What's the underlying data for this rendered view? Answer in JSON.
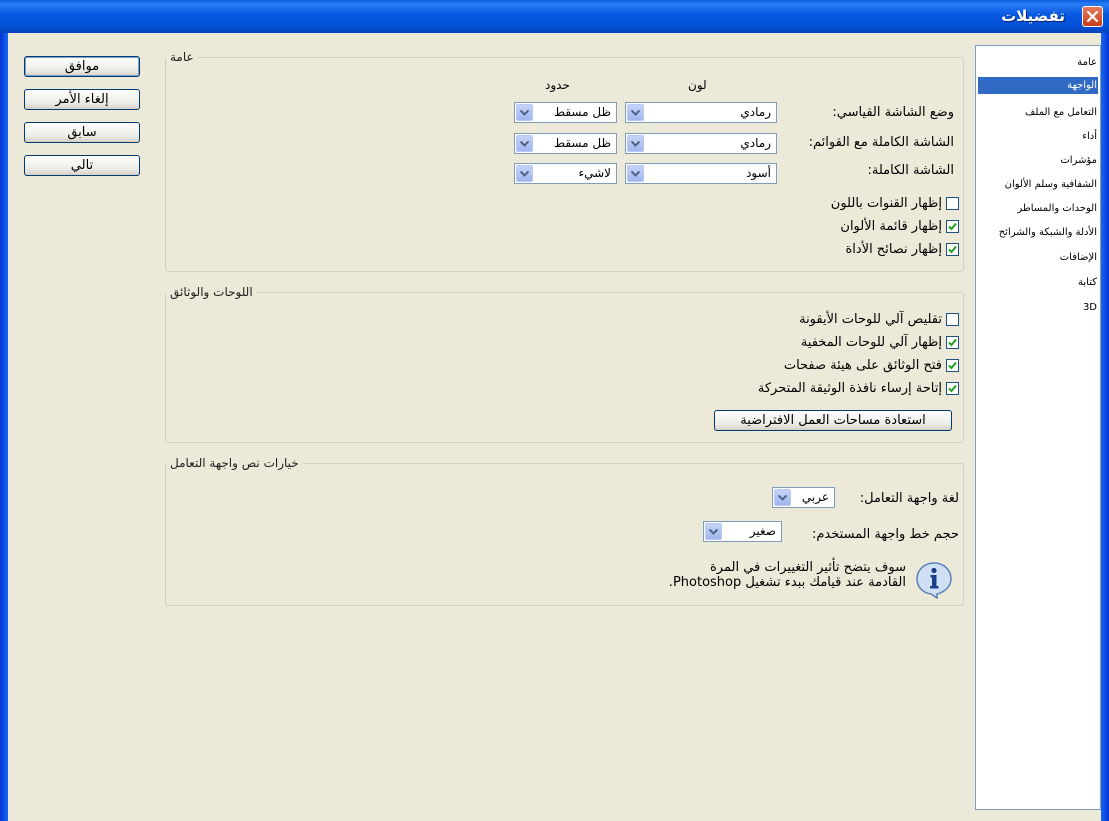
{
  "window": {
    "title": "تفضيلات"
  },
  "buttons": {
    "ok": "موافق",
    "cancel": "إلغاء الأمر",
    "prev": "سابق",
    "next": "تالي"
  },
  "sidebar": {
    "items": [
      "عامة",
      "الواجهة",
      "التعامل مع الملف",
      "أداء",
      "مؤشرات",
      "الشفافية وسلم الألوان",
      "الوحدات والمساطر",
      "الأدلة والشبكة والشرائح",
      "الإضافات",
      "كتابة",
      "3D"
    ],
    "selected": "الواجهة"
  },
  "general": {
    "legend": "عامة",
    "col_color": "لون",
    "col_border": "حدود",
    "rows": [
      {
        "label": "وضع الشاشة القياسي:",
        "color": "رمادي",
        "border": "ظل مسقط"
      },
      {
        "label": "الشاشة الكاملة مع القوائم:",
        "color": "رمادي",
        "border": "ظل مسقط"
      },
      {
        "label": "الشاشة الكاملة:",
        "color": "أسود",
        "border": "لاشيء"
      }
    ],
    "checks": [
      {
        "label": "إظهار القنوات باللون",
        "checked": false
      },
      {
        "label": "إظهار قائمة الألوان",
        "checked": true
      },
      {
        "label": "إظهار نصائح الأداة",
        "checked": true
      }
    ]
  },
  "panels": {
    "legend": "اللوحات والوثائق",
    "checks": [
      {
        "label": "تقليص آلي للوحات الأيقونة",
        "checked": false
      },
      {
        "label": "إظهار آلي للوحات المخفية",
        "checked": true
      },
      {
        "label": "فتح الوثائق على هيئة صفحات",
        "checked": true
      },
      {
        "label": "إتاحة إرساء نافذة الوثيقة المتحركة",
        "checked": true
      }
    ],
    "restore_button": "استعادة مساحات العمل الافتراضية"
  },
  "text_options": {
    "legend": "خيارات نص واجهة التعامل",
    "language_label": "لغة واجهة التعامل:",
    "language_value": "عربي",
    "font_size_label": "حجم خط واجهة المستخدم:",
    "font_size_value": "صغير",
    "info_line1": "سوف يتضح تأثير التغييرات في المرة",
    "info_line2": "القادمة عند قيامك ببدء تشغيل Photoshop."
  }
}
